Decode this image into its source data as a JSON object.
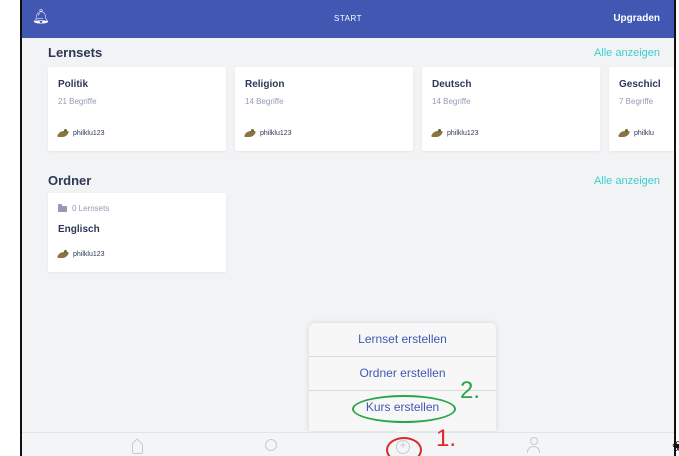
{
  "topbar": {
    "title": "START",
    "upgrade": "Upgraden"
  },
  "sets_section": {
    "title": "Lernsets",
    "show_all": "Alle anzeigen",
    "cards": [
      {
        "name": "Politik",
        "count": "21 Begriffe",
        "owner": "philklu123"
      },
      {
        "name": "Religion",
        "count": "14 Begriffe",
        "owner": "philklu123"
      },
      {
        "name": "Deutsch",
        "count": "14 Begriffe",
        "owner": "philklu123"
      },
      {
        "name": "Geschicl",
        "count": "7 Begriffe",
        "owner": "philklu"
      }
    ]
  },
  "folder_section": {
    "title": "Ordner",
    "show_all": "Alle anzeigen",
    "folder": {
      "meta": "0 Lernsets",
      "name": "Englisch",
      "owner": "philklu123"
    }
  },
  "create_menu": {
    "items": [
      "Lernset erstellen",
      "Ordner erstellen",
      "Kurs erstellen"
    ]
  },
  "annotations": {
    "step1": "1.",
    "step2": "2."
  },
  "colors": {
    "brand": "#4257b2",
    "accent": "#3ccfcf",
    "annotation_red": "#e02828",
    "annotation_green": "#2aa64a"
  },
  "tabbar": {
    "icons": [
      "home-icon",
      "search-icon",
      "plus-circle-icon",
      "profile-icon"
    ]
  }
}
